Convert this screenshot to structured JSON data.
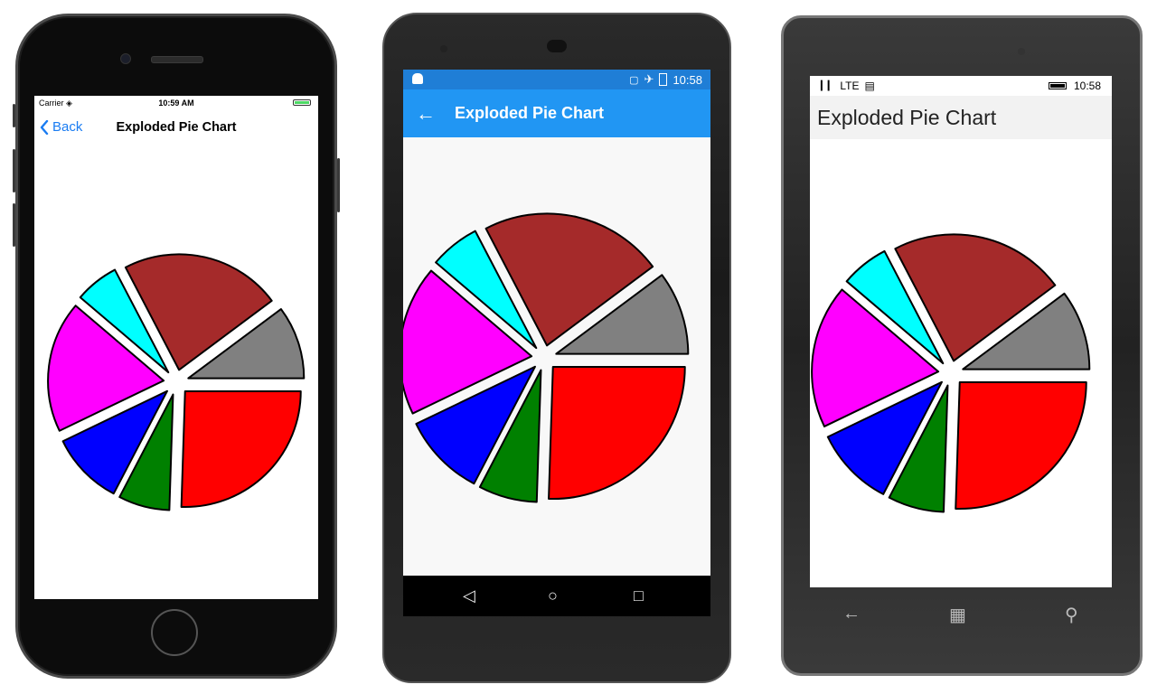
{
  "app": {
    "title": "Exploded Pie Chart"
  },
  "ios": {
    "carrier": "Carrier",
    "time": "10:59 AM",
    "back_label": "Back"
  },
  "android": {
    "time": "10:58"
  },
  "windows": {
    "network": "LTE",
    "time": "10:58"
  },
  "colors": {
    "ios_accent": "#1a7cf2",
    "android_status": "#1f7ed6",
    "android_toolbar": "#2196f3",
    "windows_titlebar": "#f2f2f2"
  },
  "icons": {
    "ios_back": "chevron-left-icon",
    "android_back": "arrow-left-icon",
    "android_nav": [
      "triangle-back-icon",
      "circle-home-icon",
      "square-recents-icon"
    ],
    "windows_nav": [
      "arrow-left-icon",
      "windows-logo-icon",
      "search-icon"
    ]
  },
  "chart_data": {
    "type": "pie",
    "exploded": true,
    "start_angle_deg": 0,
    "direction": "clockwise",
    "values": [
      25,
      7,
      10,
      18,
      6,
      22,
      10
    ],
    "colors": [
      "#ff0000",
      "#008000",
      "#0000ff",
      "#ff00ff",
      "#00ffff",
      "#a52a2a",
      "#808080"
    ]
  }
}
